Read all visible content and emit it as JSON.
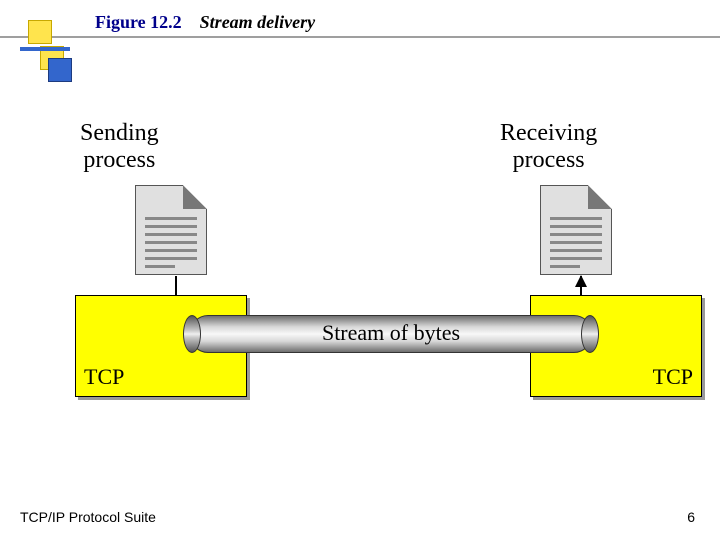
{
  "figure": {
    "number": "Figure 12.2",
    "caption": "Stream delivery"
  },
  "labels": {
    "sending": "Sending<br>process",
    "receiving": "Receiving<br>process",
    "pipe": "Stream of bytes",
    "tcp_left": "TCP",
    "tcp_right": "TCP"
  },
  "footer": {
    "left": "TCP/IP Protocol Suite",
    "page": "6"
  }
}
